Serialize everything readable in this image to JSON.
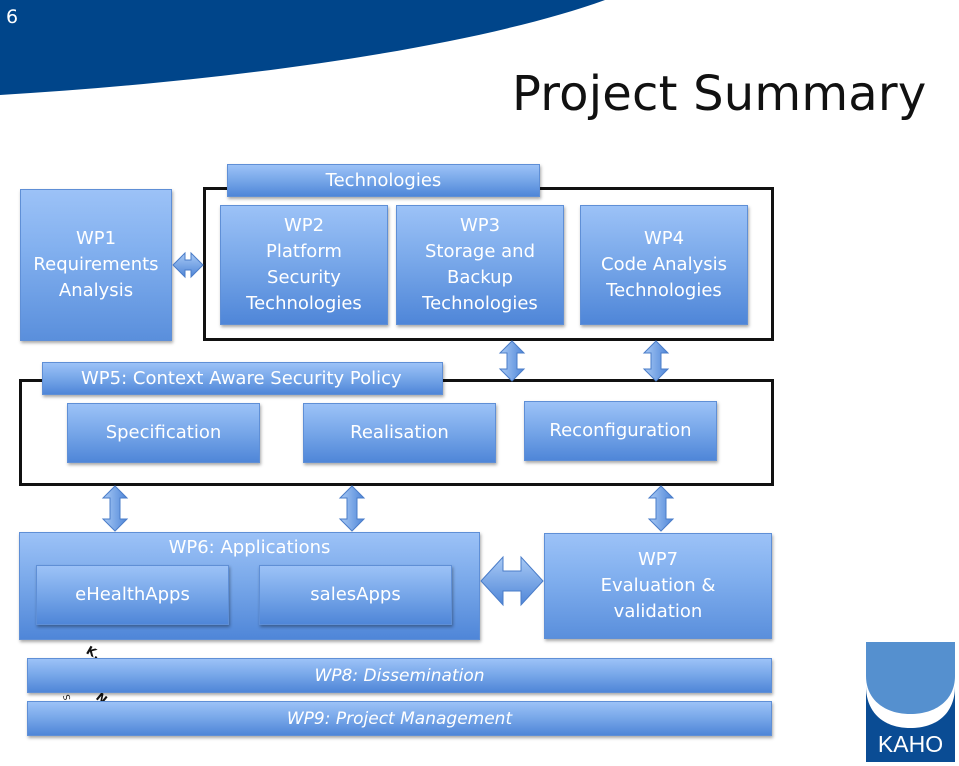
{
  "slide": {
    "number": "6",
    "title": "Project Summary"
  },
  "colors": {
    "banner": "#00458a",
    "box_top": "#9cc2f7",
    "box_bottom": "#4f86d8",
    "frame": "#111111",
    "logo_light": "#5590cf",
    "logo_dark": "#0a4c94"
  },
  "diagram": {
    "wp1": {
      "lines": [
        "WP1",
        "Requirements",
        "Analysis"
      ]
    },
    "technologies": {
      "label": "Technologies",
      "wp2": {
        "lines": [
          "WP2",
          "Platform",
          "Security",
          "Technologies"
        ]
      },
      "wp3": {
        "lines": [
          "WP3",
          "Storage and",
          "Backup",
          "Technologies"
        ]
      },
      "wp4": {
        "lines": [
          "WP4",
          "Code Analysis",
          "Technologies"
        ]
      }
    },
    "wp5": {
      "label": "WP5: Context Aware Security Policy",
      "items": [
        "Specification",
        "Realisation",
        "Reconfiguration"
      ]
    },
    "wp6": {
      "label": "WP6: Applications",
      "items": [
        "eHealthApps",
        "salesApps"
      ]
    },
    "wp7": {
      "lines": [
        "WP7",
        "Evaluation &",
        "validation"
      ]
    },
    "wp8": {
      "label": "WP8: Dissemination"
    },
    "wp9": {
      "label": "WP9: Project Management"
    },
    "arrows": [
      {
        "from": "wp1",
        "to": "technologies",
        "type": "bidirectional-horizontal"
      },
      {
        "from": "wp3",
        "to": "wp5",
        "type": "bidirectional-vertical"
      },
      {
        "from": "wp4",
        "to": "wp5",
        "type": "bidirectional-vertical"
      },
      {
        "from": "specification",
        "to": "wp6",
        "type": "bidirectional-vertical"
      },
      {
        "from": "realisation",
        "to": "wp6",
        "type": "bidirectional-vertical"
      },
      {
        "from": "reconfiguration",
        "to": "wp7",
        "type": "bidirectional-vertical"
      },
      {
        "from": "wp6",
        "to": "wp7",
        "type": "bidirectional-horizontal"
      }
    ]
  },
  "logo": {
    "text": "KAHO"
  },
  "seal": {
    "text": "TIE K."
  }
}
